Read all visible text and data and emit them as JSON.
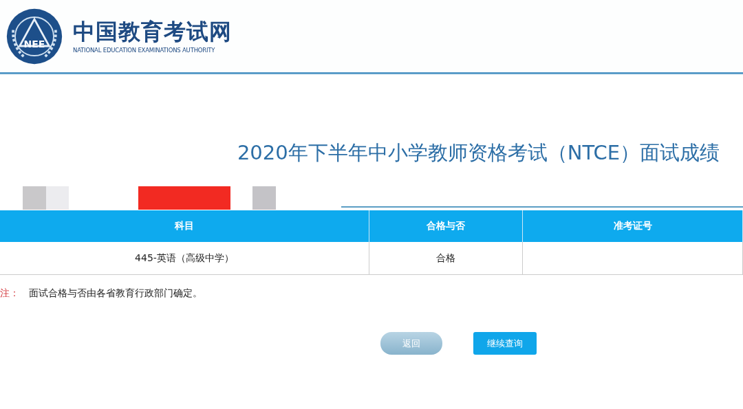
{
  "header": {
    "logo_mark": "NEE",
    "site_name": "中国教育考试网",
    "site_name_en": "NATIONAL EDUCATION EXAMINATIONS AUTHORITY"
  },
  "title": "2020年下半年中小学教师资格考试（NTCE）面试成绩",
  "table": {
    "columns": [
      "科目",
      "合格与否",
      "准考证号"
    ],
    "rows": [
      [
        "445-英语（高级中学）",
        "合格"
      ]
    ]
  },
  "note": {
    "label": "注：",
    "text": "面试合格与否由各省教育行政部门确定。"
  },
  "buttons": [
    {
      "label": "返回",
      "kind": "back"
    },
    {
      "label": "继续查询",
      "kind": "primary"
    }
  ]
}
